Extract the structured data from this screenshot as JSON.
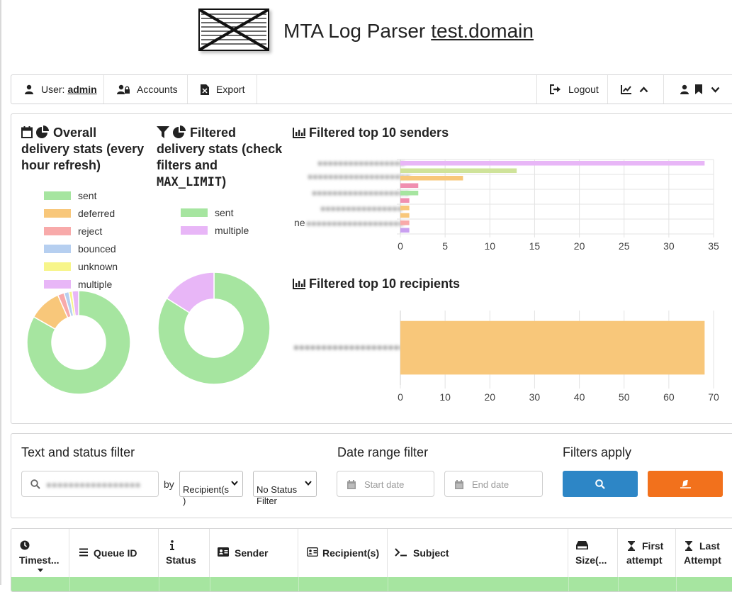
{
  "header": {
    "title": "MTA Log Parser",
    "domain": "test.domain"
  },
  "navbar": {
    "user_label": "User:",
    "user_name": "admin",
    "accounts_label": "Accounts",
    "export_label": "Export",
    "logout_label": "Logout"
  },
  "overall_stats": {
    "title_line1": "Overall",
    "title_line2": "delivery stats (every",
    "title_line3": "hour refresh)",
    "legend": [
      {
        "label": "sent",
        "color": "#a6e5a0"
      },
      {
        "label": "deferred",
        "color": "#f8c77a"
      },
      {
        "label": "reject",
        "color": "#f8aaaa"
      },
      {
        "label": "bounced",
        "color": "#b6cff0"
      },
      {
        "label": "unknown",
        "color": "#f7f58a"
      },
      {
        "label": "multiple",
        "color": "#e8b6f7"
      }
    ]
  },
  "filtered_stats": {
    "title_line1": "Filtered",
    "title_line2": "delivery stats (check",
    "title_line3": "filters and",
    "title_mono": "MAX_LIMIT",
    "title_close": ")",
    "legend": [
      {
        "label": "sent",
        "color": "#a6e5a0"
      },
      {
        "label": "multiple",
        "color": "#e8b6f7"
      }
    ]
  },
  "chart_data": [
    {
      "type": "pie",
      "labels": [
        "sent",
        "deferred",
        "reject",
        "bounced",
        "unknown",
        "multiple"
      ],
      "values": [
        82,
        10,
        2,
        1.5,
        1,
        2
      ],
      "colors": [
        "#a6e5a0",
        "#f8c77a",
        "#f8aaaa",
        "#b6cff0",
        "#f7f58a",
        "#e8b6f7"
      ],
      "donut": true
    },
    {
      "type": "pie",
      "labels": [
        "sent",
        "multiple"
      ],
      "values": [
        84,
        16
      ],
      "colors": [
        "#a6e5a0",
        "#e8b6f7"
      ],
      "donut": true
    },
    {
      "type": "bar",
      "orientation": "horizontal",
      "title": "Filtered top 10 senders",
      "categories": [
        "",
        "",
        "",
        "",
        "",
        "",
        "",
        ""
      ],
      "values": [
        34,
        13,
        7,
        2,
        2,
        1,
        1,
        1,
        1,
        1
      ],
      "colors": [
        "#e8b6f7",
        "#cfe39a",
        "#f8c77a",
        "#f08fb0",
        "#a6e5a0",
        "#f08fb0",
        "#f8c77a",
        "#f8c77a",
        "#f8aaaa",
        "#c9a0f0"
      ],
      "visible_label_fragment": "ne",
      "xticks": [
        "0",
        "5",
        "10",
        "15",
        "20",
        "25",
        "30",
        "35"
      ],
      "xlim": [
        0,
        35
      ],
      "grid": true
    },
    {
      "type": "bar",
      "orientation": "horizontal",
      "title": "Filtered top 10 recipients",
      "categories": [
        ""
      ],
      "values": [
        68
      ],
      "colors": [
        "#f8c77a"
      ],
      "xticks": [
        "0",
        "10",
        "20",
        "30",
        "40",
        "50",
        "60",
        "70"
      ],
      "xlim": [
        0,
        70
      ],
      "grid": true
    }
  ],
  "filters": {
    "text_heading": "Text and status filter",
    "by_label": "by",
    "recipient_select": "Recipient(s\n)",
    "status_select": "No Status\nFilter",
    "date_heading": "Date range filter",
    "start_placeholder": "Start date",
    "end_placeholder": "End date",
    "apply_heading": "Filters apply",
    "search_color": "#2d86c6",
    "clear_color": "#f2711c"
  },
  "table": {
    "columns": [
      {
        "line1": "",
        "line2": "Timest..."
      },
      {
        "line1": "",
        "line2": "Queue ID"
      },
      {
        "line1": "",
        "line2": "Status"
      },
      {
        "line1": "",
        "line2": "Sender"
      },
      {
        "line1": "",
        "line2": "Recipient(s)"
      },
      {
        "line1": "",
        "line2": "Subject"
      },
      {
        "line1": "",
        "line2": "Size(..."
      },
      {
        "line1": "First",
        "line2": "attempt"
      },
      {
        "line1": "Last",
        "line2": "Attempt"
      }
    ],
    "row_color": "#a6e5a0"
  }
}
